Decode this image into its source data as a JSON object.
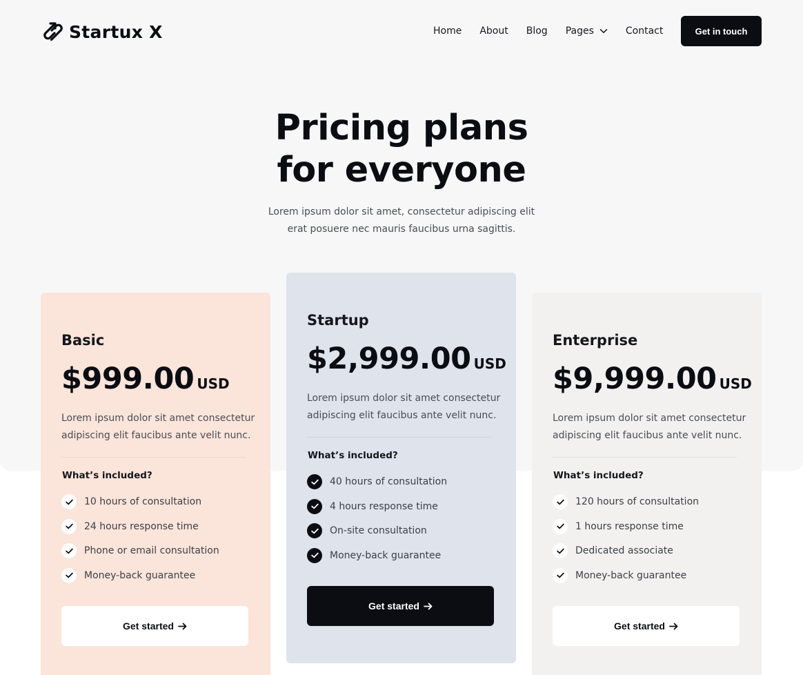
{
  "header": {
    "logo_text": "Startux X",
    "nav": [
      {
        "label": "Home"
      },
      {
        "label": "About"
      },
      {
        "label": "Blog"
      },
      {
        "label": "Pages"
      },
      {
        "label": "Contact"
      }
    ],
    "cta_label": "Get in touch"
  },
  "hero": {
    "title_line1": "Pricing plans",
    "title_line2": "for everyone",
    "subtitle": "Lorem ipsum dolor sit amet, consectetur adipiscing elit erat posuere nec mauris faucibus urna sagittis."
  },
  "plans": [
    {
      "name": "Basic",
      "price": "$999.00",
      "currency": "USD",
      "description": "Lorem ipsum dolor sit amet consectetur adipiscing elit faucibus ante velit nunc.",
      "included_title": "What’s included?",
      "features": [
        "10 hours of consultation",
        "24 hours response time",
        "Phone or email consultation",
        "Money-back guarantee"
      ],
      "button_label": "Get started"
    },
    {
      "name": "Startup",
      "price": "$2,999.00",
      "currency": "USD",
      "description": "Lorem ipsum dolor sit amet consectetur adipiscing elit faucibus ante velit nunc.",
      "included_title": "What’s included?",
      "features": [
        "40 hours of consultation",
        "4 hours response time",
        "On-site consultation",
        "Money-back guarantee"
      ],
      "button_label": "Get started"
    },
    {
      "name": "Enterprise",
      "price": "$9,999.00",
      "currency": "USD",
      "description": "Lorem ipsum dolor sit amet consectetur adipiscing elit faucibus ante velit nunc.",
      "included_title": "What’s included?",
      "features": [
        "120 hours of consultation",
        "1 hours response time",
        "Dedicated associate",
        "Money-back guarantee"
      ],
      "button_label": "Get started"
    }
  ],
  "colors": {
    "accent_dark": "#0b0d12",
    "basic_card_bg": "#fbe4da",
    "startup_card_bg": "#dee3ec",
    "enterprise_card_bg": "#f2f1f0",
    "hero_bg": "#f7f7f8"
  },
  "icons": {
    "logo": "link-arrow-logo-icon",
    "nav_dropdown": "chevron-down-icon",
    "feature": "check-circle-icon",
    "button": "arrow-right-icon"
  }
}
